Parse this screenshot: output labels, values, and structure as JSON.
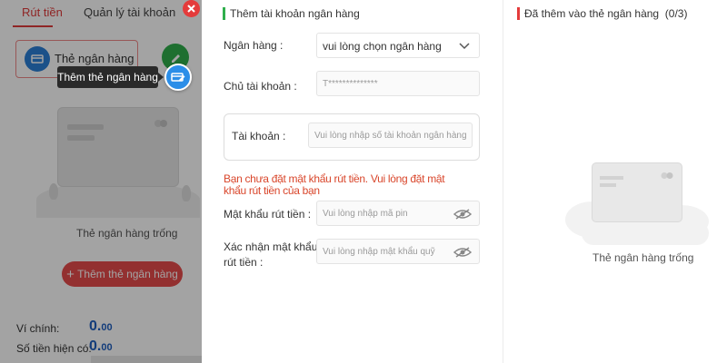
{
  "background": {
    "tabs": [
      "Rút tiền",
      "Quản lý tài khoản"
    ],
    "bank_tab_label": "Thẻ ngân hàng",
    "empty_text": "Thẻ ngân hàng trống",
    "add_button": "Thêm thẻ ngân hàng",
    "main_balance_label": "Ví chính:",
    "main_balance_value": "0.",
    "main_balance_decimals": "00",
    "current_balance_label": "Số tiền hiện có:",
    "current_balance_value": "0.",
    "current_balance_decimals": "00"
  },
  "tooltip": "Thêm thẻ ngân hàng",
  "form": {
    "title": "Thêm tài khoản ngân hàng",
    "bank_label": "Ngân hàng :",
    "bank_value": "vui lòng chọn ngân hàng",
    "holder_label": "Chủ tài khoản :",
    "holder_value": "T**************",
    "account_label": "Tài khoản :",
    "account_placeholder": "Vui lòng nhập số tài khoản ngân hàng",
    "warning": "Bạn chưa đặt mật khẩu rút tiền. Vui lòng đặt mật khẩu rút tiền của bạn",
    "pin_label": "Mật khẩu rút tiền :",
    "pin_placeholder": "Vui lòng nhập mã pin",
    "confirm_label_1": "Xác nhận mật khẩu",
    "confirm_label_2": "rút tiền :",
    "confirm_placeholder": "Vui lòng nhập mật khẩu quỹ"
  },
  "added": {
    "title": "Đã thêm vào thẻ ngân hàng",
    "count": "(0/3)",
    "empty_text": "Thẻ ngân hàng trống"
  },
  "colors": {
    "accent_red": "#e43b3b",
    "accent_green": "#2fae4c",
    "accent_blue": "#2b8ee8",
    "warning_text": "#d9462b"
  },
  "icons": [
    "bank-card-icon",
    "edit-icon",
    "add-card-icon",
    "close-icon",
    "chevron-down-icon",
    "eye-off-icon",
    "plus-icon"
  ]
}
